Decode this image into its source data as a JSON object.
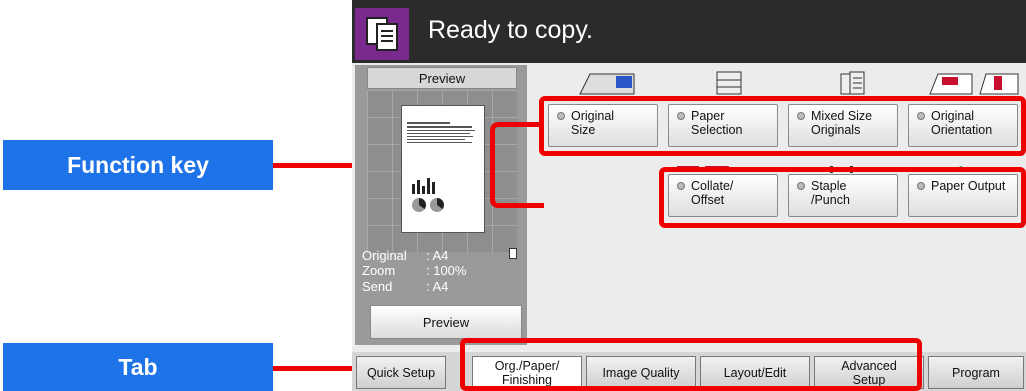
{
  "callouts": {
    "function_key": "Function key",
    "tab": "Tab"
  },
  "status": {
    "icon": "copy-icon",
    "title": "Ready to copy."
  },
  "preview": {
    "header": "Preview",
    "info": [
      {
        "key": "Original",
        "value": ": A4"
      },
      {
        "key": "Zoom",
        "value": ": 100%"
      },
      {
        "key": "Send",
        "value": ": A4"
      }
    ],
    "button": "Preview"
  },
  "function_keys": [
    {
      "line1": "Original",
      "line2": "Size",
      "icon": "original-size-icon"
    },
    {
      "line1": "Paper",
      "line2": "Selection",
      "icon": "paper-selection-icon"
    },
    {
      "line1": "Mixed Size",
      "line2": "Originals",
      "icon": "mixed-size-icon"
    },
    {
      "line1": "Original",
      "line2": "Orientation",
      "icon": "orientation-icon"
    },
    {
      "line1": "Collate/",
      "line2": "Offset",
      "icon": "collate-icon"
    },
    {
      "line1": "Staple",
      "line2": "/Punch",
      "icon": "staple-icon"
    },
    {
      "line1": "Paper Output",
      "line2": "",
      "icon": "paper-output-icon"
    }
  ],
  "tabs": [
    {
      "line1": "Quick Setup",
      "line2": ""
    },
    {
      "line1": "Org./Paper/",
      "line2": "Finishing",
      "active": true
    },
    {
      "line1": "Image Quality",
      "line2": ""
    },
    {
      "line1": "Layout/Edit",
      "line2": ""
    },
    {
      "line1": "Advanced",
      "line2": "Setup"
    },
    {
      "line1": "Program",
      "line2": ""
    }
  ],
  "colors": {
    "callout": "#1e73e8",
    "highlight": "#ee0000",
    "titlebar": "#2b2b2b",
    "icon_bg": "#7a2a8c"
  }
}
